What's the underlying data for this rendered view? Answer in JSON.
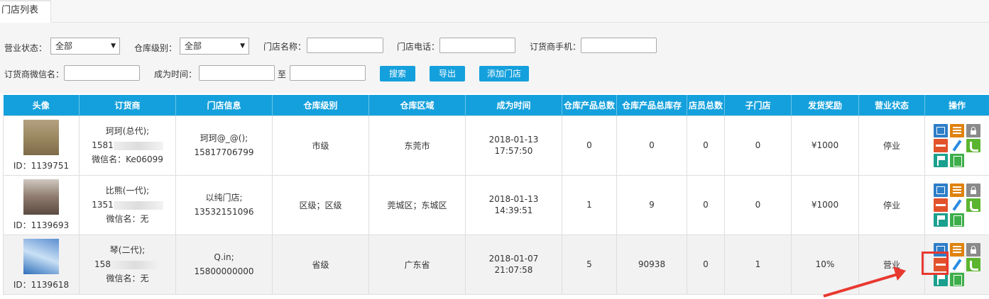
{
  "tab": {
    "label": "门店列表"
  },
  "filters": {
    "status_label": "营业状态：",
    "status_value": "全部",
    "level_label": "仓库级别：",
    "level_value": "全部",
    "name_label": "门店名称：",
    "phone_label": "门店电话：",
    "mobile_label": "订货商手机：",
    "wechat_label": "订货商微信名：",
    "time_label": "成为时间：",
    "to_label": "至",
    "search_btn": "搜索",
    "export_btn": "导出",
    "add_btn": "添加门店"
  },
  "table": {
    "headers": [
      "头像",
      "订货商",
      "门店信息",
      "仓库级别",
      "仓库区域",
      "成为时间",
      "仓库产品总数",
      "仓库产品总库存",
      "店员总数",
      "子门店",
      "发货奖励",
      "营业状态",
      "操作"
    ],
    "rows": [
      {
        "id": "ID：1139751",
        "dealer_name": "珂珂(总代);",
        "dealer_phone": "1581",
        "dealer_wechat": "微信名：Ke06099",
        "store_name": "珂珂@_@();",
        "store_phone": "15817706799",
        "level": "市级",
        "region": "东莞市",
        "date": "2018-01-13",
        "time": "17:57:50",
        "products": "0",
        "stock": "0",
        "staff": "0",
        "sub_stores": "0",
        "reward": "¥1000",
        "status": "停业"
      },
      {
        "id": "ID：1139693",
        "dealer_name": "比熊(一代);",
        "dealer_phone": "1351",
        "dealer_wechat": "微信名：无",
        "store_name": "以纯门店;",
        "store_phone": "13532151096",
        "level": "区级；区级",
        "region": "莞城区；东城区",
        "date": "2018-01-13",
        "time": "14:39:51",
        "products": "1",
        "stock": "9",
        "staff": "0",
        "sub_stores": "0",
        "reward": "¥1000",
        "status": "停业"
      },
      {
        "id": "ID：1139618",
        "dealer_name": "琴(二代);",
        "dealer_phone": "158",
        "dealer_wechat": "微信名：无",
        "store_name": "Q.in;",
        "store_phone": "15800000000",
        "level": "省级",
        "region": "广东省",
        "date": "2018-01-07",
        "time": "21:07:58",
        "products": "5",
        "stock": "90938",
        "staff": "0",
        "sub_stores": "1",
        "reward": "10%",
        "status": "营业"
      }
    ]
  },
  "colors": {
    "accent": "#14a0dc",
    "highlight": "#e8392f"
  },
  "icons": [
    "edit-icon",
    "list-icon",
    "lock-icon",
    "minus-icon",
    "pen-icon",
    "phone-icon",
    "flag-icon",
    "doc-icon"
  ]
}
